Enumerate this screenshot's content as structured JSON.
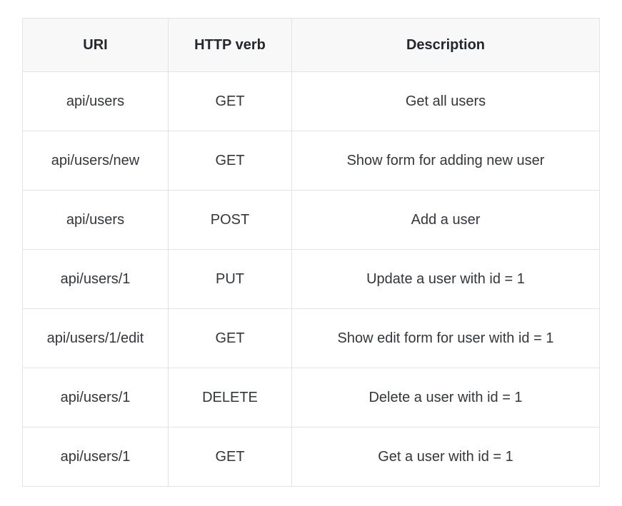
{
  "table": {
    "headers": {
      "uri": "URI",
      "verb": "HTTP verb",
      "description": "Description"
    },
    "rows": [
      {
        "uri": "api/users",
        "verb": "GET",
        "description": "Get all users"
      },
      {
        "uri": "api/users/new",
        "verb": "GET",
        "description": "Show form for adding new user"
      },
      {
        "uri": "api/users",
        "verb": "POST",
        "description": "Add a user"
      },
      {
        "uri": "api/users/1",
        "verb": "PUT",
        "description": "Update a user with id = 1"
      },
      {
        "uri": "api/users/1/edit",
        "verb": "GET",
        "description": "Show edit form for user with id = 1"
      },
      {
        "uri": "api/users/1",
        "verb": "DELETE",
        "description": "Delete a user with id = 1"
      },
      {
        "uri": "api/users/1",
        "verb": "GET",
        "description": "Get a user with id = 1"
      }
    ]
  }
}
